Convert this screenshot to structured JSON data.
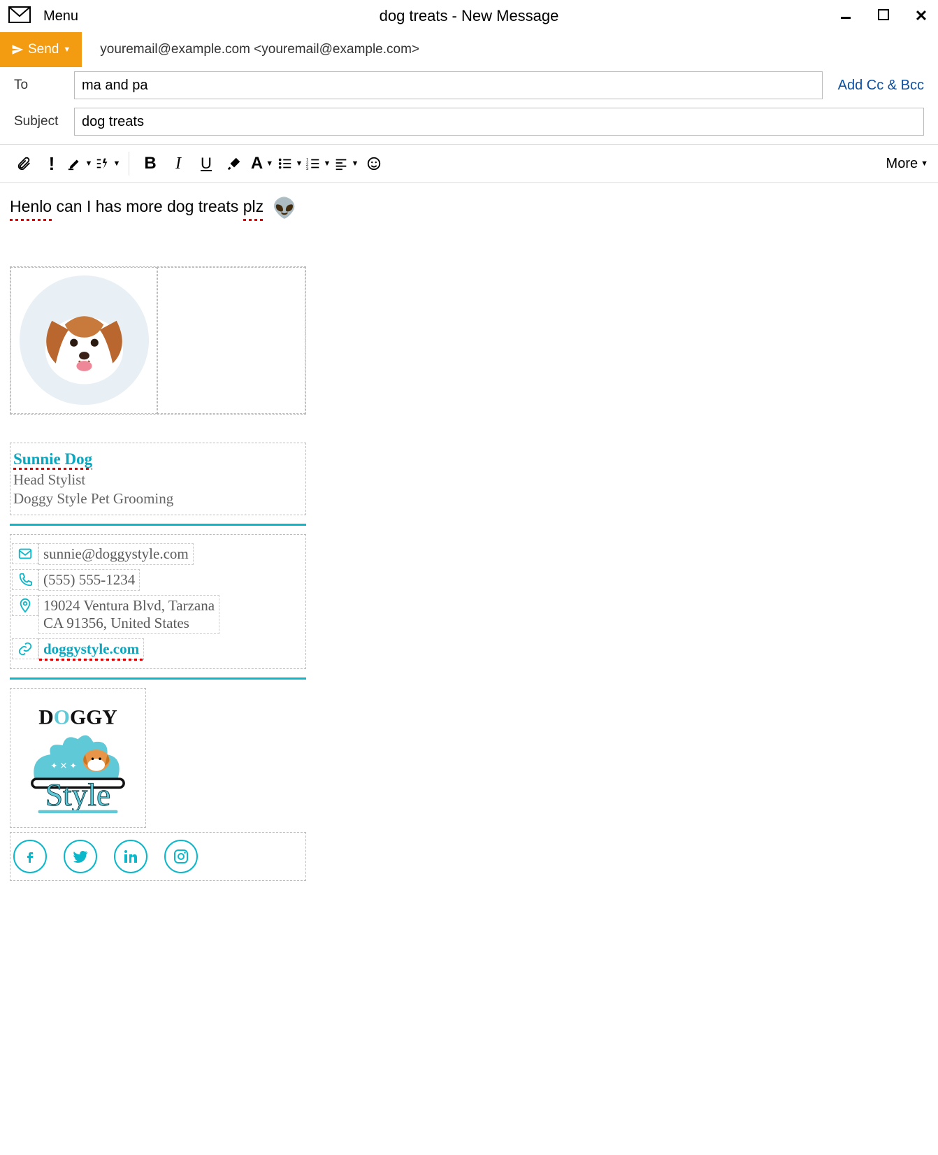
{
  "window": {
    "title": "dog treats - New Message",
    "menu_label": "Menu"
  },
  "send_button": "Send",
  "from_address": "youremail@example.com <youremail@example.com>",
  "fields": {
    "to_label": "To",
    "to_value": "ma and pa",
    "subject_label": "Subject",
    "subject_value": "dog treats",
    "add_cc_bcc": "Add Cc & Bcc"
  },
  "toolbar": {
    "more_label": "More"
  },
  "body": {
    "word1": "Henlo",
    "mid": " can I has more dog treats ",
    "word2": "plz",
    "emoji": "👽"
  },
  "signature": {
    "name": "Sunnie Dog",
    "title": "Head Stylist",
    "company": "Doggy Style Pet Grooming",
    "email": "sunnie@doggystyle.com",
    "phone": "(555) 555-1234",
    "address_line1": "19024 Ventura Blvd, Tarzana",
    "address_line2": "CA 91356, United States",
    "website": "doggystyle.com"
  }
}
